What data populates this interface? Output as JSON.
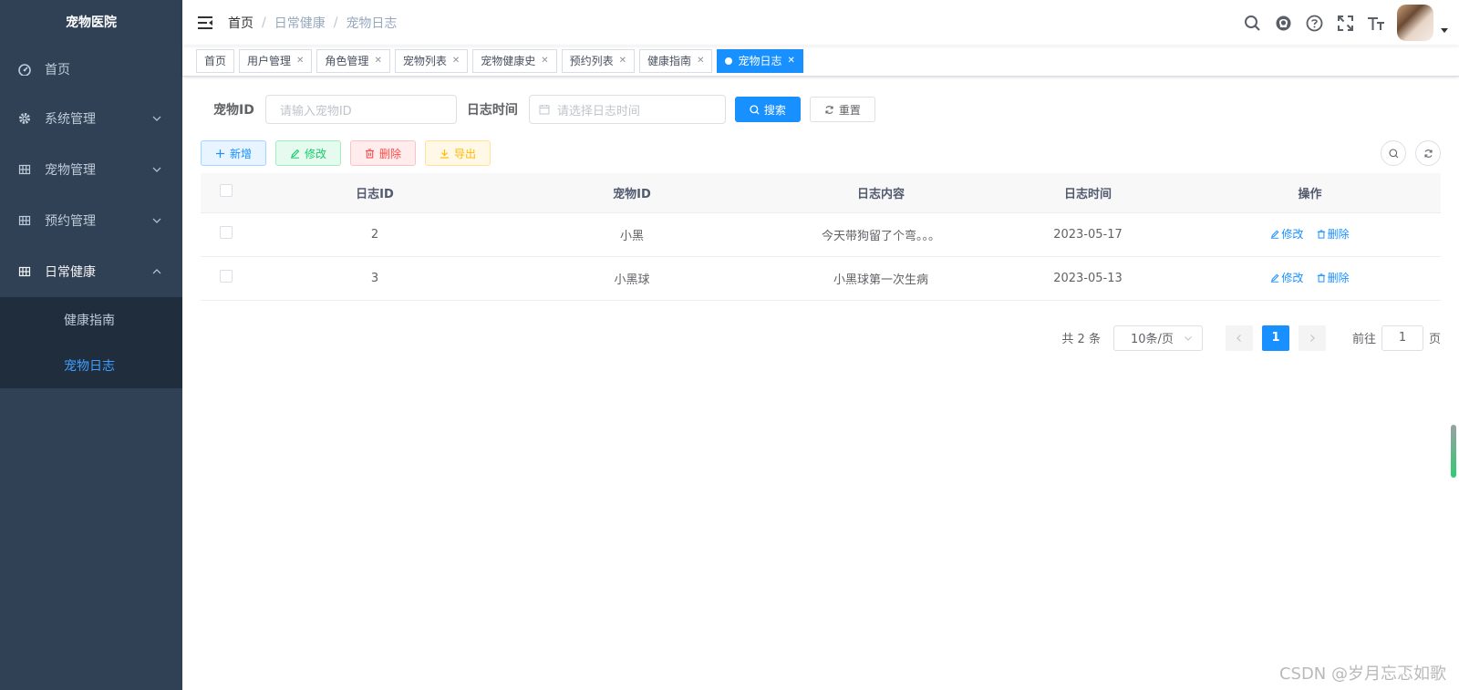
{
  "app_title": "宠物医院",
  "sidebar": {
    "items": [
      {
        "label": "首页",
        "icon": "dashboard-icon"
      },
      {
        "label": "系统管理",
        "icon": "gear-icon"
      },
      {
        "label": "宠物管理",
        "icon": "grid-icon"
      },
      {
        "label": "预约管理",
        "icon": "grid-icon"
      },
      {
        "label": "日常健康",
        "icon": "grid-icon"
      }
    ],
    "submenu": [
      {
        "label": "健康指南"
      },
      {
        "label": "宠物日志"
      }
    ]
  },
  "breadcrumb": [
    "首页",
    "日常健康",
    "宠物日志"
  ],
  "breadcrumb_sep": "/",
  "tags": [
    "首页",
    "用户管理",
    "角色管理",
    "宠物列表",
    "宠物健康史",
    "预约列表",
    "健康指南",
    "宠物日志"
  ],
  "search": {
    "pet_id_label": "宠物ID",
    "pet_id_placeholder": "请输入宠物ID",
    "log_time_label": "日志时间",
    "log_time_placeholder": "请选择日志时间",
    "search_btn": "搜索",
    "reset_btn": "重置"
  },
  "toolbar": {
    "add": "新增",
    "edit": "修改",
    "delete": "删除",
    "export": "导出"
  },
  "table": {
    "headers": [
      "日志ID",
      "宠物ID",
      "日志内容",
      "日志时间",
      "操作"
    ],
    "rows": [
      {
        "id": "2",
        "pet": "小黑",
        "content": "今天带狗留了个弯。。。",
        "time": "2023-05-17"
      },
      {
        "id": "3",
        "pet": "小黑球",
        "content": "小黑球第一次生病",
        "time": "2023-05-13"
      }
    ],
    "op_edit": "修改",
    "op_delete": "删除"
  },
  "pagination": {
    "total": "共 2 条",
    "page_size": "10条/页",
    "current": "1",
    "goto_label": "前往",
    "goto_value": "1",
    "goto_suffix": "页"
  },
  "watermark": "CSDN @岁月忘忑如歌",
  "colors": {
    "sidebar_bg": "#304156",
    "submenu_bg": "#1f2d3d",
    "primary": "#1890ff"
  }
}
